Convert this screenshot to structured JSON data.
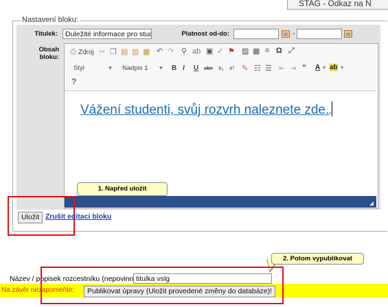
{
  "top_fragment": {
    "text": "STAG - Odkaz na N"
  },
  "fieldset": {
    "legend": "Nastavení bloku:"
  },
  "form": {
    "title_label": "Titulek:",
    "title_value": "Duležité informace pro stud",
    "validity_label": "Platnost od-do:",
    "validity_separator": "-",
    "content_label": "Obsah bloku:"
  },
  "toolbar": {
    "source_label": "Zdroj",
    "style_dropdown": "Styl",
    "format_dropdown": "Nadpis 1",
    "help": "?"
  },
  "editor": {
    "content": "Vážení studenti, svůj rozvrh naleznete zde.",
    "trailing": "."
  },
  "actions": {
    "save_button": "Uložit",
    "cancel_link": "Zrušit editaci bloku"
  },
  "callouts": {
    "first": "1. Napřed uložit",
    "second": "2. Potom vypublikovat"
  },
  "junction": {
    "label": "Název / popisek rozcestníku (nepovinný):",
    "value": "titulka vslg"
  },
  "publish": {
    "warning": "Na závěr nezapomeňte:",
    "button": "Publikovat úpravy (Uložit provedené změny do databáze)!"
  },
  "colors": {
    "accent_link": "#1c6cb4",
    "editor_footer": "#2c4f8e",
    "highlight_red": "#e01010",
    "warning_bar": "#ffff00",
    "callout_bg": "#fefec3"
  }
}
